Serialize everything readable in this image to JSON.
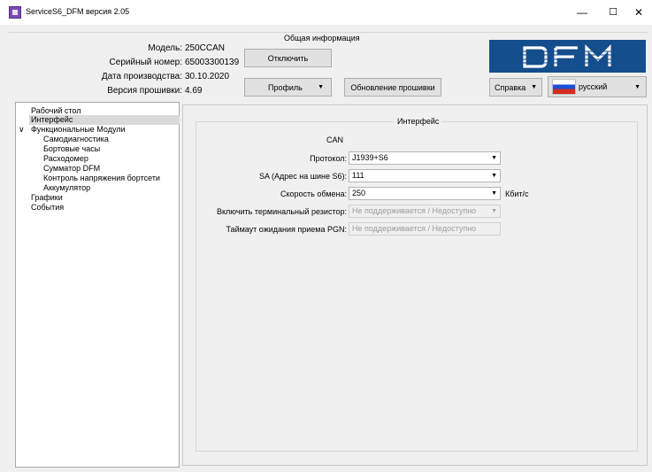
{
  "window": {
    "title": "ServiceS6_DFM версия 2.05",
    "min_glyph": "—",
    "max_glyph": "☐",
    "close_glyph": "✕"
  },
  "info": {
    "group_title": "Общая информация",
    "model_label": "Модель:",
    "model_value": "250CCAN",
    "serial_label": "Серийный номер:",
    "serial_value": "65003300139",
    "date_label": "Дата производства:",
    "date_value": "30.10.2020",
    "fw_label": "Версия прошивки:",
    "fw_value": "4.69",
    "disconnect_button": "Отключить",
    "profile_button": "Профиль",
    "firmware_update_button": "Обновление прошивки",
    "help_button": "Справка",
    "language_value": "русский",
    "logo_text": "DFM"
  },
  "tree": {
    "desktop": "Рабочий стол",
    "interface": "Интерфейс",
    "modules": "Функциональные Модули",
    "self_diag": "Самодиагностика",
    "onboard_clock": "Бортовые часы",
    "flowmeter": "Расходомер",
    "summator": "Сумматор DFM",
    "voltage_control": "Контроль напряжения бортсети",
    "battery": "Аккумулятор",
    "graphs": "Графики",
    "events": "События",
    "expand_glyph": "∨"
  },
  "iface": {
    "group_title": "Интерфейс",
    "can_label": "CAN",
    "protocol_label": "Протокол:",
    "protocol_value": "J1939+S6",
    "sa_label": "SA (Адрес на шине S6):",
    "sa_value": "111",
    "speed_label": "Скорость обмена:",
    "speed_value": "250",
    "speed_unit": "Кбит/с",
    "terminal_label": "Включить терминальный резистор:",
    "terminal_value": "Не поддерживается / Недоступно",
    "pgn_label": "Таймаут ожидания приема PGN:",
    "pgn_value": "Не поддерживается / Недоступно"
  },
  "colors": {
    "accent_selection": "#d9d9d9",
    "logo_bg": "#154e8c"
  }
}
